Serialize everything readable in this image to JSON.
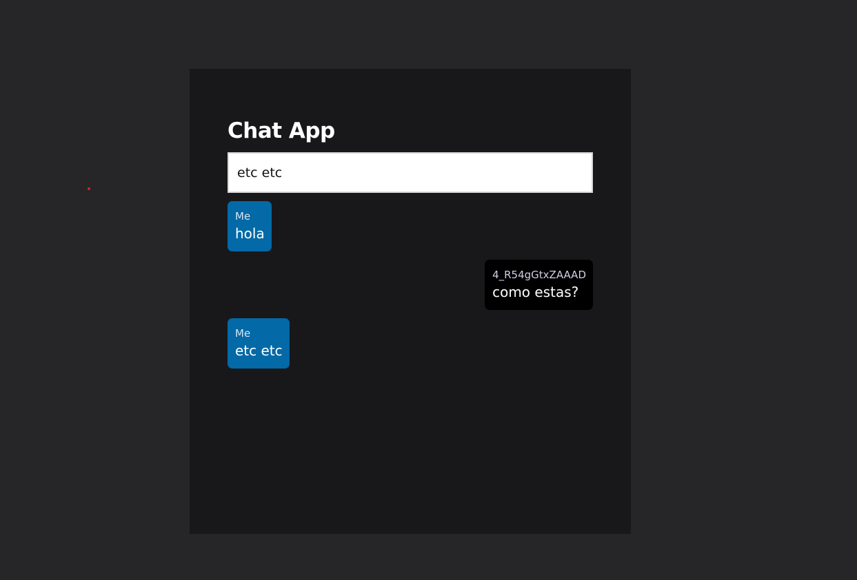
{
  "app": {
    "title": "Chat App"
  },
  "composer": {
    "value": "etc etc"
  },
  "messages": [
    {
      "sender": "Me",
      "text": "hola",
      "mine": true
    },
    {
      "sender": "4_R54gGtxZAAAD",
      "text": "como estas?",
      "mine": false
    },
    {
      "sender": "Me",
      "text": "etc etc",
      "mine": true
    }
  ],
  "colors": {
    "page_background": "#262628",
    "panel_background": "#18181a",
    "my_bubble": "#0369a7",
    "other_bubble": "#000000"
  }
}
